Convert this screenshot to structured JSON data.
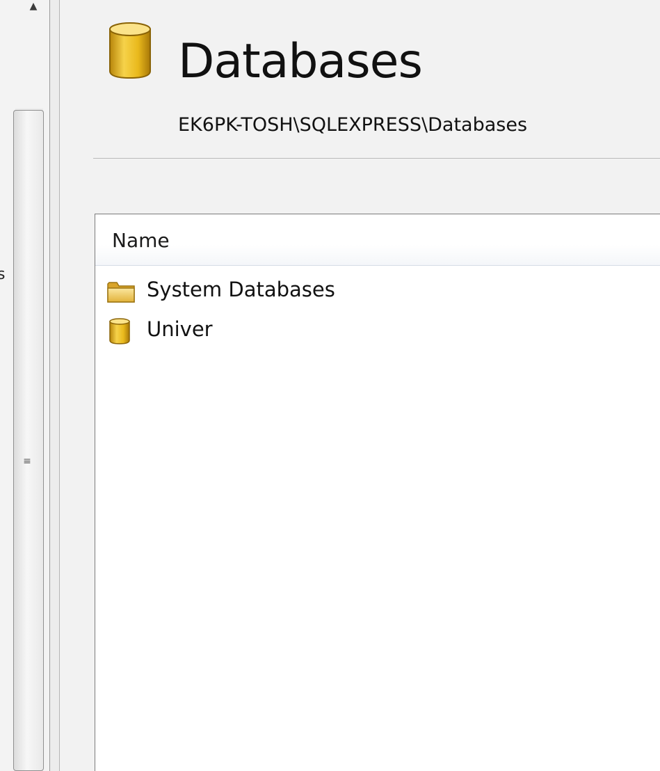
{
  "left_pane": {
    "partial_text": "s",
    "grip_glyph": "≡",
    "scroll_up_glyph": "▲"
  },
  "header": {
    "title": "Databases",
    "path": "EK6PK-TOSH\\SQLEXPRESS\\Databases",
    "icon": "database-icon"
  },
  "list": {
    "columns": [
      "Name"
    ],
    "rows": [
      {
        "label": "System Databases",
        "icon": "folder-icon"
      },
      {
        "label": "Univer",
        "icon": "database-icon"
      }
    ]
  },
  "colors": {
    "icon_gold": "#e9b91c",
    "icon_gold_dark": "#b8860b",
    "folder_yellow": "#f3cf5c"
  }
}
